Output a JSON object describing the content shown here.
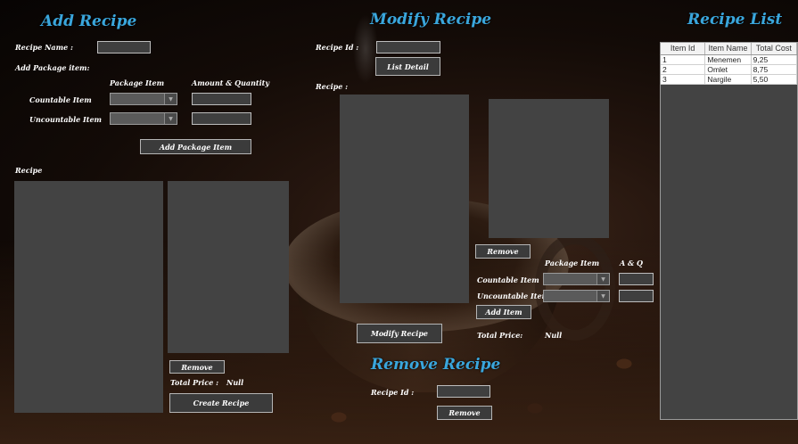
{
  "add_recipe": {
    "title": "Add Recipe",
    "recipe_name_label": "Recipe Name :",
    "recipe_name_value": "",
    "add_package_item_label": "Add Package item:",
    "package_item_header": "Package Item",
    "amount_quantity_header": "Amount & Quantity",
    "countable_item_label": "Countable Item",
    "uncountable_item_label": "Uncountable Item",
    "add_package_item_button": "Add Package Item",
    "recipe_label": "Recipe",
    "remove_button": "Remove",
    "total_price_label": "Total Price :",
    "total_price_value": "Null",
    "create_recipe_button": "Create Recipe"
  },
  "modify_recipe": {
    "title": "Modify Recipe",
    "recipe_id_label": "Recipe Id :",
    "list_detail_button": "List Detail",
    "recipe_label": "Recipe :",
    "remove_button": "Remove",
    "package_item_header": "Package Item",
    "aq_header": "A & Q",
    "countable_item_label": "Countable Item",
    "uncountable_item_label": "Uncountable Item",
    "add_item_button": "Add Item",
    "total_price_label": "Total Price:",
    "total_price_value": "Null",
    "modify_recipe_button": "Modify Recipe"
  },
  "remove_recipe": {
    "title": "Remove Recipe",
    "recipe_id_label": "Recipe Id :",
    "remove_button": "Remove"
  },
  "recipe_list": {
    "title": "Recipe List",
    "columns": [
      "Item Id",
      "Item Name",
      "Total Cost"
    ],
    "rows": [
      [
        "1",
        "Menemen",
        "9,25"
      ],
      [
        "2",
        "Omlet",
        "8,75"
      ],
      [
        "3",
        "Nargile",
        "5,50"
      ]
    ]
  },
  "colors": {
    "heading": "#3aa6dc",
    "panel": "#434343",
    "background": "#1a0f09"
  }
}
